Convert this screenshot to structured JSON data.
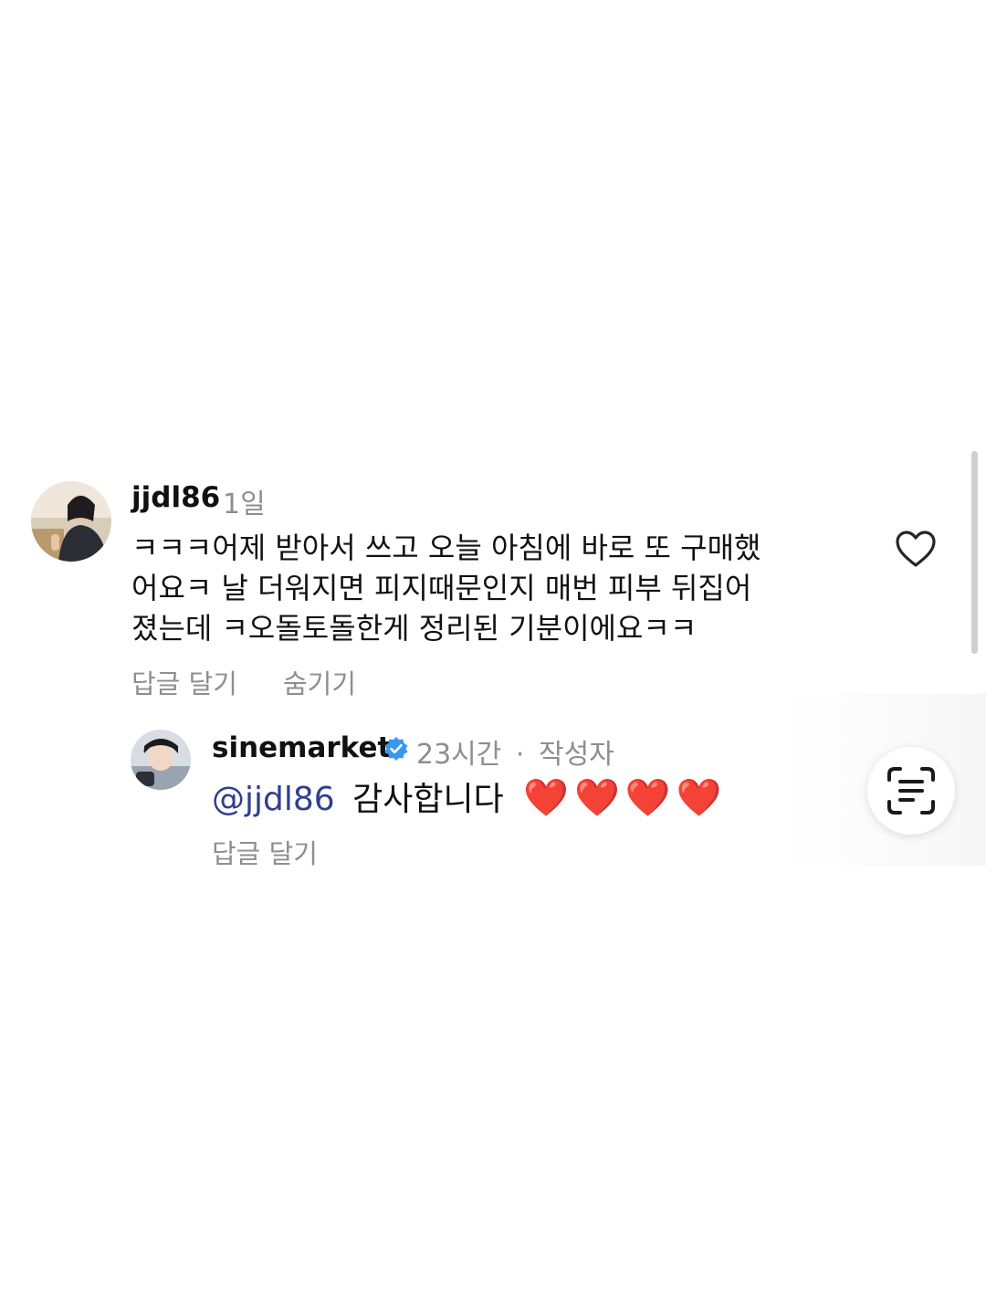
{
  "comment": {
    "username": "jjdl86",
    "time": "1일",
    "lines": [
      "ㅋㅋㅋ어제 받아서 쓰고 오늘 아침에 바로 또 구매했",
      "어요ㅋ 날 더워지면 피지때문인지 매번 피부 뒤집어",
      "졌는데 ㅋ오돌토돌한게 정리된 기분이에요ㅋㅋ"
    ],
    "reply_label": "답글 달기",
    "hide_label": "숨기기",
    "like_icon": "heart-outline-icon"
  },
  "reply": {
    "username": "sinemarket",
    "verified_icon": "verified-badge-icon",
    "time": "23시간",
    "separator": "·",
    "author_tag": "작성자",
    "mention": "@jjdl86",
    "text": "감사합니다",
    "emoji": "❤️❤️❤️❤️",
    "reply_label": "답글 달기"
  },
  "scan_button": {
    "icon": "text-scan-icon"
  },
  "colors": {
    "mention": "#2f3f8f",
    "secondary_text": "#8e8e8e",
    "verified": "#3897f0",
    "heart": "#e5202a"
  }
}
